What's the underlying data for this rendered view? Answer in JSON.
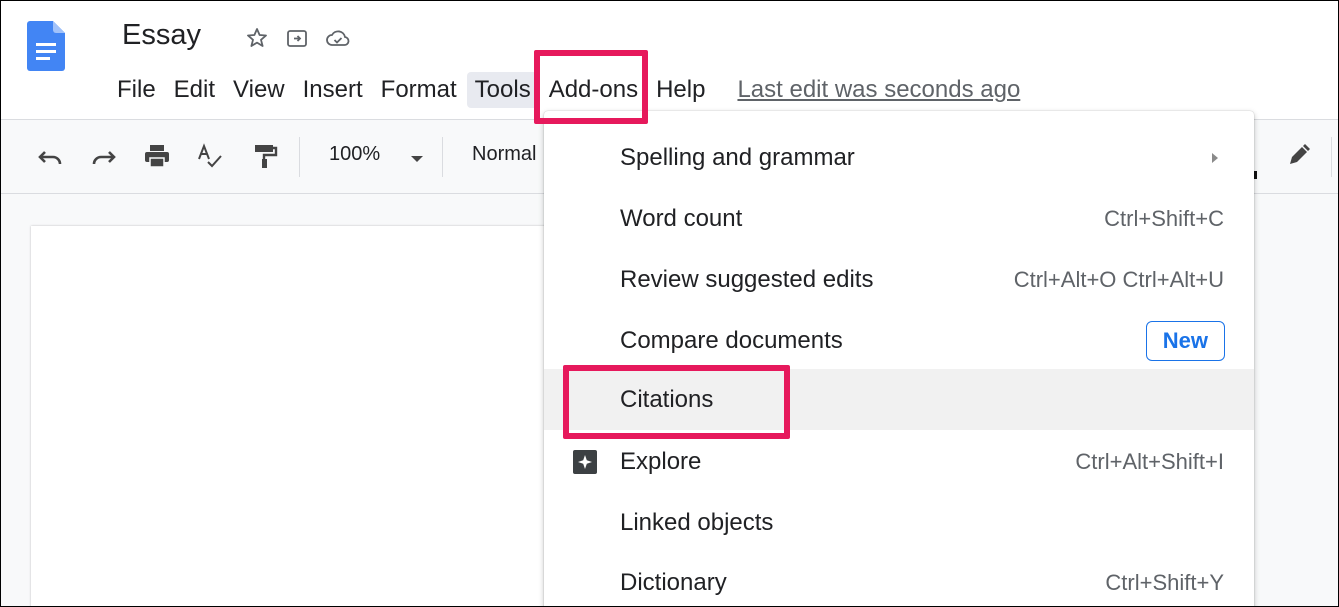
{
  "document": {
    "title": "Essay",
    "last_edit": "Last edit was seconds ago"
  },
  "menubar": {
    "items": [
      {
        "label": "File"
      },
      {
        "label": "Edit"
      },
      {
        "label": "View"
      },
      {
        "label": "Insert"
      },
      {
        "label": "Format"
      },
      {
        "label": "Tools",
        "active": true
      },
      {
        "label": "Add-ons"
      },
      {
        "label": "Help"
      }
    ]
  },
  "toolbar": {
    "zoom": "100%",
    "paragraph_style": "Normal"
  },
  "tools_menu": {
    "items": [
      {
        "label": "Spelling and grammar",
        "submenu": true
      },
      {
        "label": "Word count",
        "shortcut": "Ctrl+Shift+C"
      },
      {
        "label": "Review suggested edits",
        "shortcut": "Ctrl+Alt+O Ctrl+Alt+U"
      },
      {
        "label": "Compare documents",
        "badge": "New"
      },
      {
        "label": "Citations",
        "hovered": true
      },
      {
        "label": "Explore",
        "shortcut": "Ctrl+Alt+Shift+I",
        "icon": "explore-icon"
      },
      {
        "label": "Linked objects"
      },
      {
        "label": "Dictionary",
        "shortcut": "Ctrl+Shift+Y"
      }
    ]
  },
  "colors": {
    "highlight": "#e6195c",
    "doc_blue": "#4285f4",
    "new_badge": "#1a73e8"
  }
}
